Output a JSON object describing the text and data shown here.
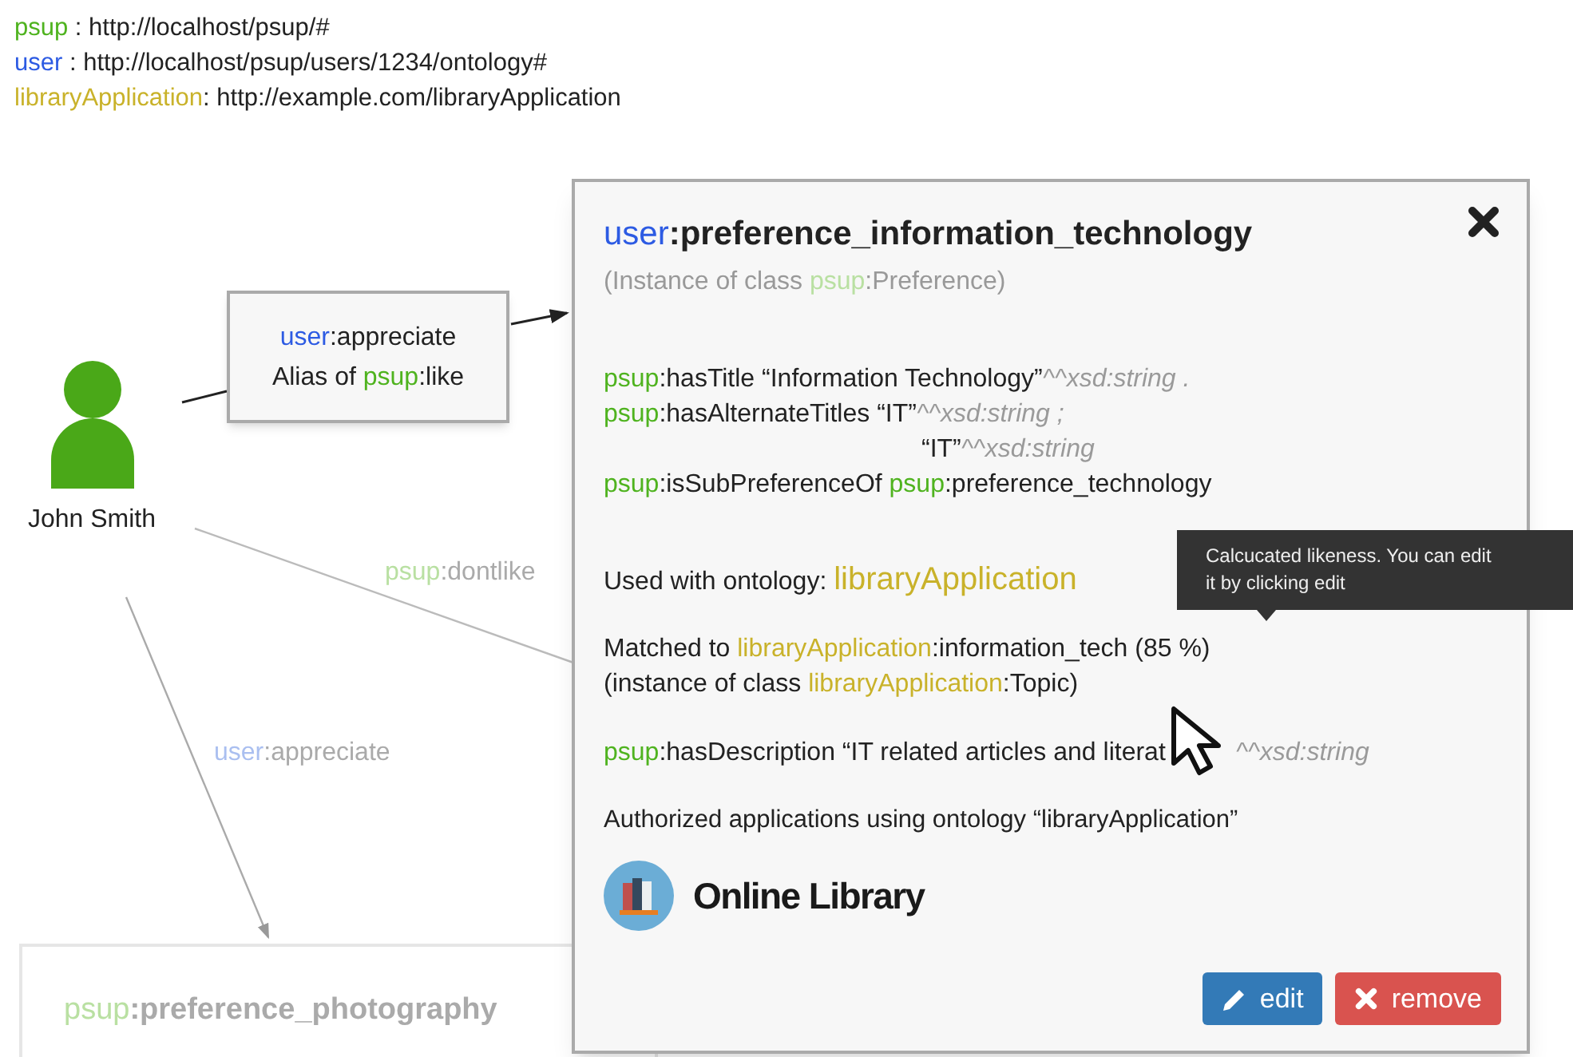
{
  "prefixes": [
    [
      {
        "t": "psup",
        "kind": "psup"
      },
      {
        "t": " : http://localhost/psup/#"
      }
    ],
    [
      {
        "t": "user",
        "kind": "user"
      },
      {
        "t": " : http://localhost/psup/users/1234/ontology#"
      }
    ],
    [
      {
        "t": "libraryApplication",
        "kind": "lib"
      },
      {
        "t": ": http://example.com/libraryApplication"
      }
    ]
  ],
  "person": {
    "name": "John Smith"
  },
  "edge_box": {
    "lines": [
      [
        {
          "t": "user",
          "kind": "user"
        },
        {
          "t": ":appreciate"
        }
      ],
      [
        {
          "t": "Alias of "
        },
        {
          "t": "psup",
          "kind": "psup"
        },
        {
          "t": ":like"
        }
      ]
    ]
  },
  "edge_labels": [
    {
      "faded": true,
      "segments": [
        {
          "t": "psup",
          "kind": "psup"
        },
        {
          "t": ":dontlike"
        }
      ]
    },
    {
      "faded": true,
      "segments": [
        {
          "t": "user",
          "kind": "user"
        },
        {
          "t": ":appreciate"
        }
      ]
    }
  ],
  "node": {
    "faded": true,
    "segments": [
      {
        "t": "psup",
        "kind": "psup"
      },
      {
        "t": ":preference_photography"
      }
    ]
  },
  "popup": {
    "title": [
      {
        "t": "user",
        "kind": "user"
      },
      {
        "t": ":preference_information_technology"
      }
    ],
    "subtitle": [
      {
        "t": "(Instance of class "
      },
      {
        "t": "psup",
        "kind": "psup"
      },
      {
        "t": ":Preference)"
      }
    ],
    "triples": [
      [
        {
          "t": "psup",
          "kind": "psup"
        },
        {
          "t": ":hasTitle “Information Technology”"
        },
        {
          "t": "^^xsd:string .",
          "kind": "type"
        }
      ],
      [
        {
          "t": "psup",
          "kind": "psup"
        },
        {
          "t": ":hasAlternateTitles “IT”"
        },
        {
          "t": "^^xsd:string ;",
          "kind": "type"
        }
      ],
      [
        {
          "t": "“IT”"
        },
        {
          "t": "^^xsd:string",
          "kind": "type"
        }
      ],
      [
        {
          "t": "psup",
          "kind": "psup"
        },
        {
          "t": ":isSubPreferenceOf "
        },
        {
          "t": "psup",
          "kind": "psup"
        },
        {
          "t": ":preference_technology"
        }
      ]
    ],
    "used_with": [
      {
        "t": "Used with ontology: "
      },
      {
        "t": "libraryApplication",
        "kind": "lib"
      }
    ],
    "matched": [
      [
        {
          "t": "Matched to "
        },
        {
          "t": "libraryApplication",
          "kind": "lib"
        },
        {
          "t": ":information_tech (85 %)"
        }
      ],
      [
        {
          "t": "(instance of class "
        },
        {
          "t": "libraryApplication",
          "kind": "lib"
        },
        {
          "t": ":Topic)"
        }
      ]
    ],
    "description": {
      "before": [
        {
          "t": "psup",
          "kind": "psup"
        },
        {
          "t": ":hasDescription “IT related articles and literat"
        }
      ],
      "after": [
        {
          "t": "^^xsd:string",
          "kind": "type"
        }
      ]
    },
    "authorized": "Authorized applications using ontology “libraryApplication”",
    "app": "Online Library",
    "buttons": [
      {
        "kind": "edit",
        "label": "edit"
      },
      {
        "kind": "remove",
        "label": "remove"
      }
    ]
  },
  "tooltip": "Calcucated likeness. You can edit it by clicking edit"
}
